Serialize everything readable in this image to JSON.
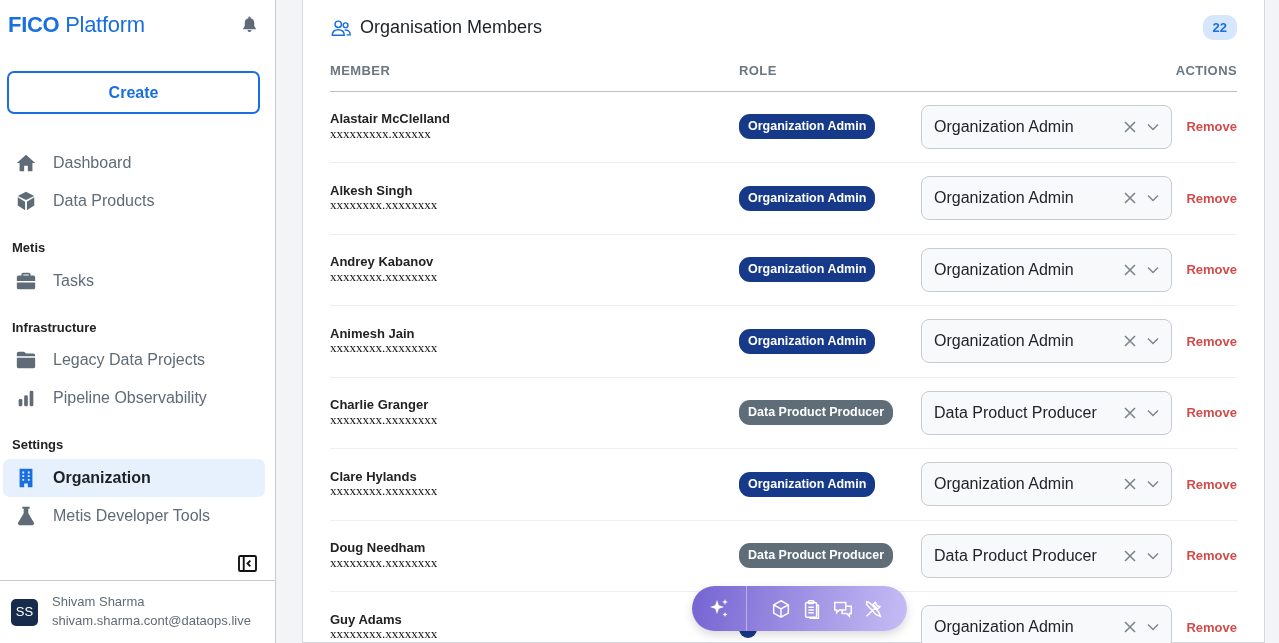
{
  "sidebar": {
    "logo_bold": "FICO",
    "logo_rest": "Platform",
    "create_button": "Create",
    "sections": [
      {
        "items": [
          {
            "label": "Dashboard",
            "selected": false
          },
          {
            "label": "Data Products",
            "selected": false
          }
        ]
      },
      {
        "title": "Metis",
        "items": [
          {
            "label": "Tasks",
            "selected": false
          }
        ]
      },
      {
        "title": "Infrastructure",
        "items": [
          {
            "label": "Legacy Data Projects",
            "selected": false
          },
          {
            "label": "Pipeline Observability",
            "selected": false
          }
        ]
      },
      {
        "title": "Settings",
        "items": [
          {
            "label": "Organization",
            "selected": true
          },
          {
            "label": "Metis Developer Tools",
            "selected": false
          }
        ]
      }
    ],
    "user": {
      "initials": "SS",
      "name": "Shivam Sharma",
      "email": "shivam.sharma.cont@dataops.live"
    }
  },
  "members_card": {
    "title": "Organisation Members",
    "count": "22",
    "columns": [
      "MEMBER",
      "ROLE",
      "ACTIONS"
    ],
    "rows": [
      {
        "name": "Alastair McClelland",
        "email": "xxxxxxxxx.xxxxxx",
        "role": "Organization Admin",
        "kind": "admin",
        "select_value": "Organization Admin",
        "action": "Remove"
      },
      {
        "name": "Alkesh Singh",
        "email": "xxxxxxxx.xxxxxxxx",
        "role": "Organization Admin",
        "kind": "admin",
        "select_value": "Organization Admin",
        "action": "Remove"
      },
      {
        "name": "Andrey Kabanov",
        "email": "xxxxxxxx.xxxxxxxx",
        "role": "Organization Admin",
        "kind": "admin",
        "select_value": "Organization Admin",
        "action": "Remove"
      },
      {
        "name": "Animesh Jain",
        "email": "xxxxxxxx.xxxxxxxx",
        "role": "Organization Admin",
        "kind": "admin",
        "select_value": "Organization Admin",
        "action": "Remove"
      },
      {
        "name": "Charlie Granger",
        "email": "xxxxxxxx.xxxxxxxx",
        "role": "Data Product Producer",
        "kind": "producer",
        "select_value": "Data Product Producer",
        "action": "Remove"
      },
      {
        "name": "Clare Hylands",
        "email": "xxxxxxxx.xxxxxxxx",
        "role": "Organization Admin",
        "kind": "admin",
        "select_value": "Organization Admin",
        "action": "Remove"
      },
      {
        "name": "Doug Needham",
        "email": "xxxxxxxx.xxxxxxxx",
        "role": "Data Product Producer",
        "kind": "producer",
        "select_value": "Data Product Producer",
        "action": "Remove"
      },
      {
        "name": "Guy Adams",
        "email": "xxxxxxxx.xxxxxxxx",
        "kind": "admin",
        "select_value": "Organization Admin",
        "action": "Remove"
      }
    ]
  }
}
